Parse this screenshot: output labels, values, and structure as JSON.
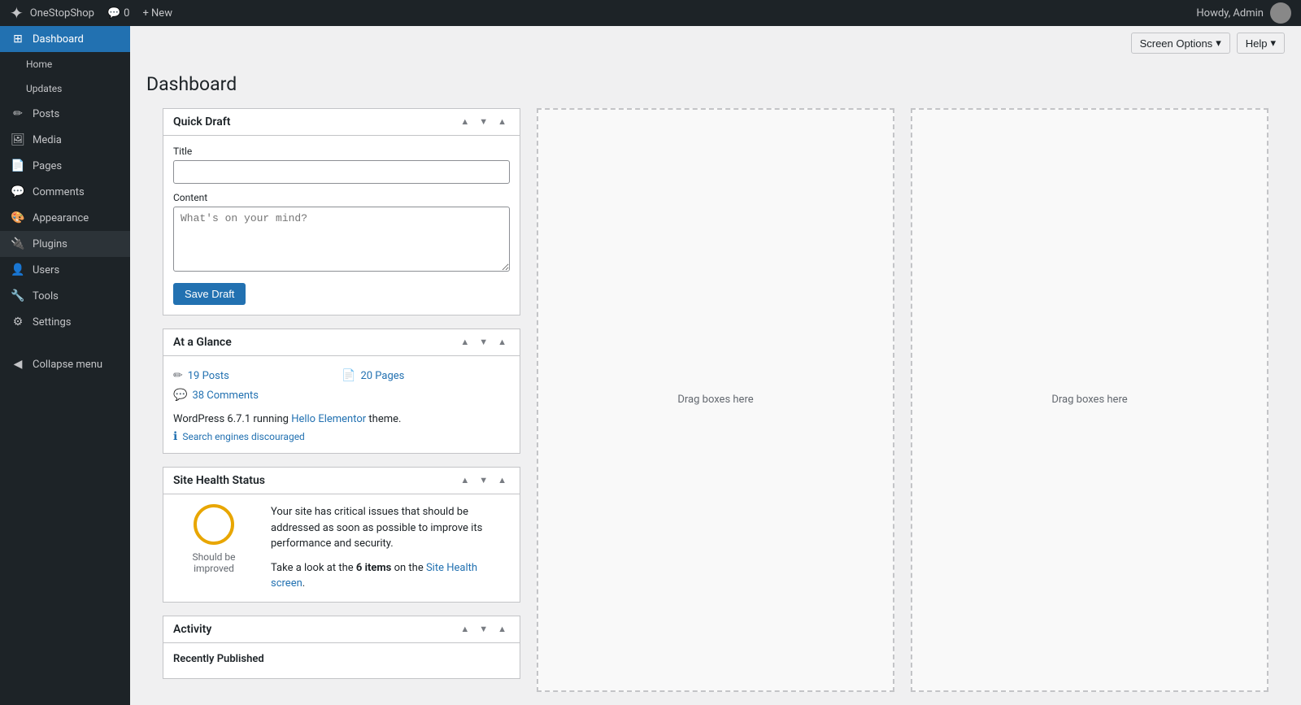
{
  "adminbar": {
    "logo": "✦",
    "site_name": "OneStopShop",
    "comments_icon": "💬",
    "comments_count": "0",
    "new_label": "+ New",
    "howdy_text": "Howdy, Admin",
    "screen_options_label": "Screen Options",
    "help_label": "Help"
  },
  "sidebar": {
    "home_label": "Home",
    "updates_label": "Updates",
    "dashboard_label": "Dashboard",
    "posts_label": "Posts",
    "media_label": "Media",
    "pages_label": "Pages",
    "comments_label": "Comments",
    "appearance_label": "Appearance",
    "plugins_label": "Plugins",
    "users_label": "Users",
    "tools_label": "Tools",
    "settings_label": "Settings",
    "collapse_label": "Collapse menu"
  },
  "page": {
    "title": "Dashboard"
  },
  "quick_draft": {
    "title": "Quick Draft",
    "title_label": "Title",
    "content_label": "Content",
    "content_placeholder": "What's on your mind?",
    "save_button": "Save Draft"
  },
  "drag_areas": {
    "text1": "Drag boxes here",
    "text2": "Drag boxes here"
  },
  "at_a_glance": {
    "title": "At a Glance",
    "posts_count": "19 Posts",
    "pages_count": "20 Pages",
    "comments_count": "38 Comments",
    "wp_version_text": "WordPress 6.7.1 running ",
    "theme_name": "Hello Elementor",
    "theme_suffix": " theme.",
    "search_engines_text": "Search engines discouraged"
  },
  "site_health": {
    "title": "Site Health Status",
    "label": "Should be improved",
    "description_text": "Your site has critical issues that should be addressed as soon as possible to improve its performance and security.",
    "items_text": "Take a look at the ",
    "items_count": "6 items",
    "items_suffix": " on the ",
    "link_text": "Site Health screen",
    "link_suffix": "."
  },
  "activity": {
    "title": "Activity",
    "recently_published_label": "Recently Published"
  }
}
